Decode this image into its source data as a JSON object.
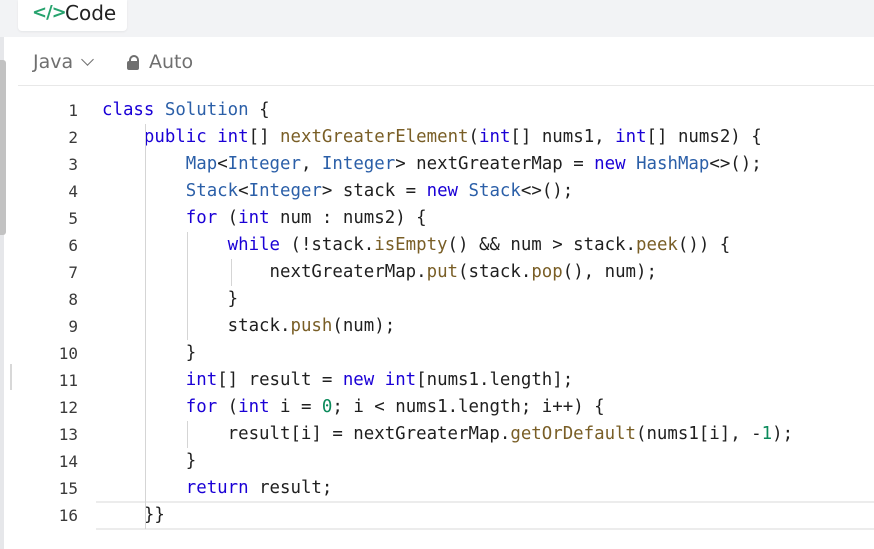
{
  "header": {
    "tab_icon": "</>",
    "tab_label": "Code"
  },
  "toolbar": {
    "language": "Java",
    "mode": "Auto"
  },
  "editor": {
    "line_numbers": [
      "1",
      "2",
      "3",
      "4",
      "5",
      "6",
      "7",
      "8",
      "9",
      "10",
      "11",
      "12",
      "13",
      "14",
      "15",
      "16"
    ],
    "lines": [
      [
        {
          "t": "class",
          "c": "kw"
        },
        {
          "t": " "
        },
        {
          "t": "Solution",
          "c": "type"
        },
        {
          "t": " {"
        }
      ],
      [
        {
          "t": "    "
        },
        {
          "t": "public",
          "c": "kw"
        },
        {
          "t": " "
        },
        {
          "t": "int",
          "c": "kw"
        },
        {
          "t": "[] "
        },
        {
          "t": "nextGreaterElement",
          "c": "fn"
        },
        {
          "t": "("
        },
        {
          "t": "int",
          "c": "kw"
        },
        {
          "t": "[] nums1, "
        },
        {
          "t": "int",
          "c": "kw"
        },
        {
          "t": "[] nums2) {"
        }
      ],
      [
        {
          "t": "        "
        },
        {
          "t": "Map",
          "c": "type"
        },
        {
          "t": "<"
        },
        {
          "t": "Integer",
          "c": "type"
        },
        {
          "t": ", "
        },
        {
          "t": "Integer",
          "c": "type"
        },
        {
          "t": "> nextGreaterMap = "
        },
        {
          "t": "new",
          "c": "kw"
        },
        {
          "t": " "
        },
        {
          "t": "HashMap",
          "c": "type"
        },
        {
          "t": "<>();"
        }
      ],
      [
        {
          "t": "        "
        },
        {
          "t": "Stack",
          "c": "type"
        },
        {
          "t": "<"
        },
        {
          "t": "Integer",
          "c": "type"
        },
        {
          "t": "> stack = "
        },
        {
          "t": "new",
          "c": "kw"
        },
        {
          "t": " "
        },
        {
          "t": "Stack",
          "c": "type"
        },
        {
          "t": "<>();"
        }
      ],
      [
        {
          "t": "        "
        },
        {
          "t": "for",
          "c": "kw"
        },
        {
          "t": " ("
        },
        {
          "t": "int",
          "c": "kw"
        },
        {
          "t": " num : nums2) {"
        }
      ],
      [
        {
          "t": "            "
        },
        {
          "t": "while",
          "c": "kw"
        },
        {
          "t": " (!stack."
        },
        {
          "t": "isEmpty",
          "c": "fn"
        },
        {
          "t": "() && num > stack."
        },
        {
          "t": "peek",
          "c": "fn"
        },
        {
          "t": "()) {"
        }
      ],
      [
        {
          "t": "                "
        },
        {
          "t": "nextGreaterMap."
        },
        {
          "t": "put",
          "c": "fn"
        },
        {
          "t": "(stack."
        },
        {
          "t": "pop",
          "c": "fn"
        },
        {
          "t": "(), num);"
        }
      ],
      [
        {
          "t": "            }"
        }
      ],
      [
        {
          "t": "            stack."
        },
        {
          "t": "push",
          "c": "fn"
        },
        {
          "t": "(num);"
        }
      ],
      [
        {
          "t": "        }"
        }
      ],
      [
        {
          "t": "        "
        },
        {
          "t": "int",
          "c": "kw"
        },
        {
          "t": "[] result = "
        },
        {
          "t": "new",
          "c": "kw"
        },
        {
          "t": " "
        },
        {
          "t": "int",
          "c": "kw"
        },
        {
          "t": "[nums1.length];"
        }
      ],
      [
        {
          "t": "        "
        },
        {
          "t": "for",
          "c": "kw"
        },
        {
          "t": " ("
        },
        {
          "t": "int",
          "c": "kw"
        },
        {
          "t": " i = "
        },
        {
          "t": "0",
          "c": "num"
        },
        {
          "t": "; i < nums1.length; i++) {"
        }
      ],
      [
        {
          "t": "            result[i] = nextGreaterMap."
        },
        {
          "t": "getOrDefault",
          "c": "fn"
        },
        {
          "t": "(nums1[i], -"
        },
        {
          "t": "1",
          "c": "num"
        },
        {
          "t": ");"
        }
      ],
      [
        {
          "t": "        }"
        }
      ],
      [
        {
          "t": "        "
        },
        {
          "t": "return",
          "c": "kw"
        },
        {
          "t": " result;"
        }
      ],
      [
        {
          "t": "    }}"
        }
      ]
    ]
  },
  "colors": {
    "keyword": "#1a00d6",
    "type": "#2b5fa8",
    "function": "#795e26",
    "number": "#0b8a5b",
    "accent": "#27a36e"
  }
}
